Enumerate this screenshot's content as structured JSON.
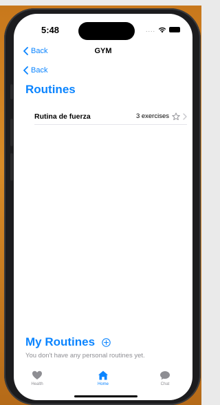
{
  "status": {
    "time": "5:48",
    "signal_dots": "...."
  },
  "nav": {
    "back_label": "Back",
    "title": "GYM"
  },
  "secondary_back_label": "Back",
  "routines_section": {
    "title": "Routines",
    "items": [
      {
        "name": "Rutina de fuerza",
        "count": "3 exercises"
      }
    ]
  },
  "my_routines": {
    "title": "My Routines",
    "empty_text": "You don't have any personal routines yet."
  },
  "tabs": [
    {
      "label": "Health",
      "icon": "heart-icon",
      "active": false
    },
    {
      "label": "Home",
      "icon": "house-icon",
      "active": true
    },
    {
      "label": "Chat",
      "icon": "chat-bubble-icon",
      "active": false
    }
  ],
  "colors": {
    "accent": "#0a84ff",
    "inactive": "#8e8e93"
  }
}
